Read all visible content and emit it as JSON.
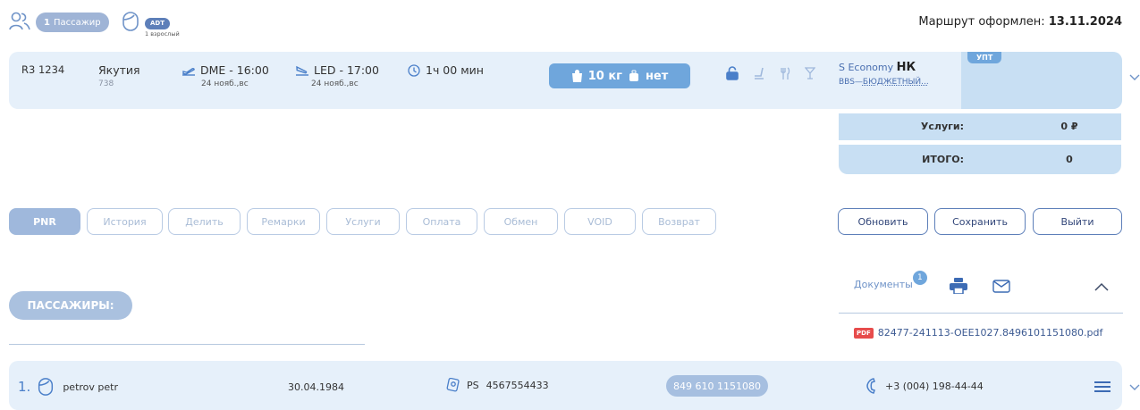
{
  "header": {
    "passenger_count": "1",
    "passenger_label": "Пассажир",
    "pax_type": "ADT",
    "pax_type_desc": "1 взрослый",
    "route_status_label": "Маршрут оформлен:",
    "route_status_date": "13.11.2024"
  },
  "flight": {
    "code": "R3 1234",
    "aircraft": "738",
    "airline": "Якутия",
    "dep": "DME - 16:00",
    "dep_date": "24 нояб.,вс",
    "arr": "LED - 17:00",
    "arr_date": "24 нояб.,вс",
    "duration": "1ч 00 мин",
    "baggage": "10 кг",
    "hand_luggage": "нет",
    "service_class": "S Economy",
    "fare_code": "НК",
    "fare_basis": "BBS",
    "fare_name": "БЮДЖЕТНЫЙ...",
    "upt_tag": "УПТ"
  },
  "totals": {
    "services_label": "Услуги:",
    "services_value": "0 ₽",
    "total_label": "ИТОГО:",
    "total_value": "0"
  },
  "actions": [
    "PNR",
    "История",
    "Делить",
    "Ремарки",
    "Услуги",
    "Оплата",
    "Обмен",
    "VOID",
    "Возврат"
  ],
  "right_actions": {
    "refresh": "Обновить",
    "save": "Сохранить",
    "exit": "Выйти"
  },
  "passengers_section": {
    "title": "ПАССАЖИРЫ:"
  },
  "documents": {
    "label": "Документы",
    "count": "1",
    "file_type": "PDF",
    "file_name": "82477-241113-OEE1027.8496101151080.pdf"
  },
  "passenger": {
    "index": "1.",
    "name": "petrov petr",
    "birth_date": "30.04.1984",
    "doc_type": "PS",
    "doc_number": "4567554433",
    "ticket": "849 610 1151080",
    "phone": "+3 (004) 198-44-44"
  },
  "colors": {
    "accent": "#5d7fb9",
    "light_row": "#e6f0fa",
    "mid_blue": "#c8dff3",
    "button_blue": "#6fa6dc",
    "pdf_red": "#e74c4c"
  }
}
